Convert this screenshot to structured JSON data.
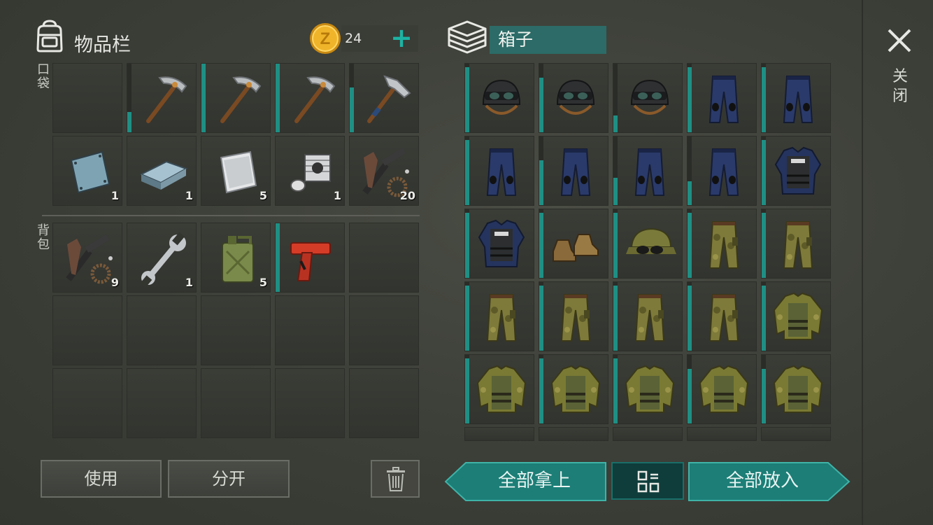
{
  "inventory": {
    "title": "物品栏",
    "coins": "24",
    "plus": "+",
    "pocket_label": "口袋",
    "backpack_label": "背包"
  },
  "box": {
    "title": "箱子"
  },
  "close_label": "关闭",
  "buttons": {
    "use": "使用",
    "split": "分开",
    "take_all": "全部拿上",
    "put_all": "全部放入"
  },
  "colors": {
    "accent": "#1db3a3",
    "durability": "#1f8f84",
    "teal_button": "#1f8c84"
  },
  "pocket_slots": [
    {
      "icon": "empty",
      "qty": "",
      "dur": 0
    },
    {
      "icon": "pickaxe-icon",
      "qty": "",
      "dur": 0.3
    },
    {
      "icon": "pickaxe-icon",
      "qty": "",
      "dur": 1.0
    },
    {
      "icon": "pickaxe-icon",
      "qty": "",
      "dur": 1.0
    },
    {
      "icon": "hammer-icon",
      "qty": "",
      "dur": 0.65
    },
    {
      "icon": "metal-plate-icon",
      "qty": "1",
      "dur": 0
    },
    {
      "icon": "iron-ingot-icon",
      "qty": "1",
      "dur": 0
    },
    {
      "icon": "aluminum-sheet-icon",
      "qty": "5",
      "dur": 0
    },
    {
      "icon": "engine-cylinder-icon",
      "qty": "1",
      "dur": 0
    },
    {
      "icon": "spare-parts-icon",
      "qty": "20",
      "dur": 0
    }
  ],
  "backpack_slots": [
    {
      "icon": "spare-parts-icon",
      "qty": "9",
      "dur": 0
    },
    {
      "icon": "wrench-icon",
      "qty": "1",
      "dur": 0
    },
    {
      "icon": "jerry-can-icon",
      "qty": "5",
      "dur": 0
    },
    {
      "icon": "flare-gun-icon",
      "qty": "",
      "dur": 1.0
    },
    {
      "icon": "empty",
      "qty": "",
      "dur": 0
    },
    {
      "icon": "empty",
      "qty": "",
      "dur": 0
    },
    {
      "icon": "empty",
      "qty": "",
      "dur": 0
    },
    {
      "icon": "empty",
      "qty": "",
      "dur": 0
    },
    {
      "icon": "empty",
      "qty": "",
      "dur": 0
    },
    {
      "icon": "empty",
      "qty": "",
      "dur": 0
    },
    {
      "icon": "empty",
      "qty": "",
      "dur": 0
    },
    {
      "icon": "empty",
      "qty": "",
      "dur": 0
    },
    {
      "icon": "empty",
      "qty": "",
      "dur": 0
    },
    {
      "icon": "empty",
      "qty": "",
      "dur": 0
    },
    {
      "icon": "empty",
      "qty": "",
      "dur": 0
    }
  ],
  "box_slots": [
    {
      "icon": "helmet-icon",
      "qty": "",
      "dur": 0.95
    },
    {
      "icon": "helmet-icon",
      "qty": "",
      "dur": 0.8
    },
    {
      "icon": "helmet-icon",
      "qty": "",
      "dur": 0.25
    },
    {
      "icon": "police-pants-icon",
      "qty": "",
      "dur": 0.95
    },
    {
      "icon": "police-pants-icon",
      "qty": "",
      "dur": 0.95
    },
    {
      "icon": "police-pants-icon",
      "qty": "",
      "dur": 0.95
    },
    {
      "icon": "police-pants-icon",
      "qty": "",
      "dur": 0.65
    },
    {
      "icon": "police-pants-icon",
      "qty": "",
      "dur": 0.4
    },
    {
      "icon": "police-pants-icon",
      "qty": "",
      "dur": 0.35
    },
    {
      "icon": "police-vest-icon",
      "qty": "",
      "dur": 0.95
    },
    {
      "icon": "police-vest-icon",
      "qty": "",
      "dur": 0.95
    },
    {
      "icon": "boots-icon",
      "qty": "",
      "dur": 0.95
    },
    {
      "icon": "camo-cap-icon",
      "qty": "",
      "dur": 0.95
    },
    {
      "icon": "camo-pants-icon",
      "qty": "",
      "dur": 0.95
    },
    {
      "icon": "camo-pants-icon",
      "qty": "",
      "dur": 0.95
    },
    {
      "icon": "camo-pants-icon",
      "qty": "",
      "dur": 0.95
    },
    {
      "icon": "camo-pants-icon",
      "qty": "",
      "dur": 0.95
    },
    {
      "icon": "camo-pants-icon",
      "qty": "",
      "dur": 0.95
    },
    {
      "icon": "camo-pants-icon",
      "qty": "",
      "dur": 0.95
    },
    {
      "icon": "camo-jacket-icon",
      "qty": "",
      "dur": 0.95
    },
    {
      "icon": "camo-jacket-icon",
      "qty": "",
      "dur": 0.95
    },
    {
      "icon": "camo-jacket-icon",
      "qty": "",
      "dur": 0.95
    },
    {
      "icon": "camo-jacket-icon",
      "qty": "",
      "dur": 0.95
    },
    {
      "icon": "camo-jacket-icon",
      "qty": "",
      "dur": 0.8
    },
    {
      "icon": "camo-jacket-icon",
      "qty": "",
      "dur": 0.8
    }
  ]
}
